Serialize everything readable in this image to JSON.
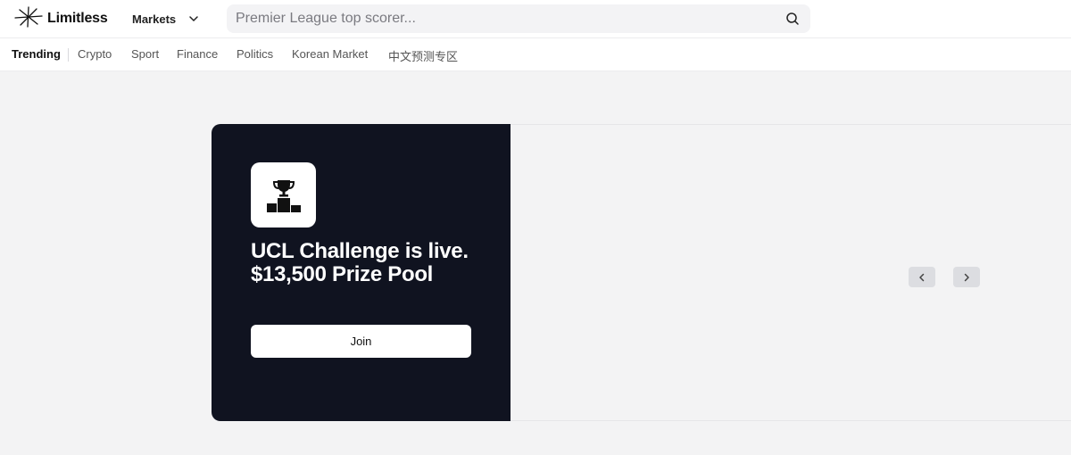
{
  "header": {
    "logo_text": "Limitless",
    "markets_label": "Markets",
    "search_placeholder": "Premier League top scorer..."
  },
  "categories": [
    {
      "label": "Trending",
      "active": true
    },
    {
      "label": "Crypto"
    },
    {
      "label": "Sport"
    },
    {
      "label": "Finance"
    },
    {
      "label": "Politics"
    },
    {
      "label": "Korean Market"
    },
    {
      "label": "中文预测专区"
    }
  ],
  "banner": {
    "headline_line1": "UCL Challenge is live.",
    "headline_line2": "$13,500 Prize Pool",
    "join_label": "Join",
    "icon": "trophy-podium-icon"
  },
  "carousel": {
    "prev_icon": "chevron-left-icon",
    "next_icon": "chevron-right-icon"
  },
  "colors": {
    "banner_bg": "#101320",
    "page_bg": "#f3f3f4",
    "arrow_bg": "#dcdde1"
  }
}
